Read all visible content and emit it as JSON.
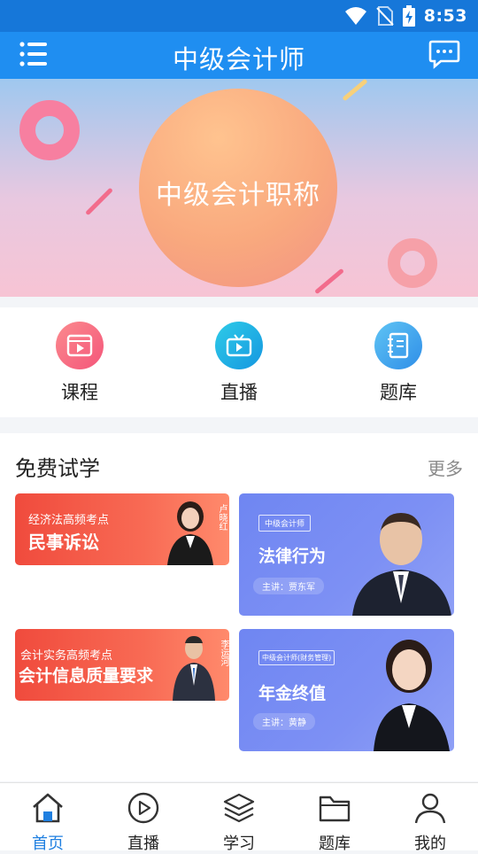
{
  "status_bar": {
    "time": "8:53"
  },
  "header": {
    "title": "中级会计师"
  },
  "banner": {
    "text": "中级会计职称"
  },
  "shortcuts": [
    {
      "label": "课程",
      "icon": "video-play-icon",
      "color": "#f86a76"
    },
    {
      "label": "直播",
      "icon": "tv-icon",
      "color": "#1cb8e6"
    },
    {
      "label": "题库",
      "icon": "notebook-icon",
      "color": "#3aa7ef"
    }
  ],
  "free_trial": {
    "title": "免费试学",
    "more": "更多",
    "cards": [
      {
        "sub": "经济法高频考点",
        "main": "民事诉讼",
        "signature": "卢晓红"
      },
      {
        "tag": "中级会计师",
        "main": "法律行为",
        "lecturer": "主讲：贾东军"
      },
      {
        "sub": "会计实务高频考点",
        "main": "会计信息质量要求",
        "signature": "李运河"
      },
      {
        "tag": "中级会计师(财务管理)",
        "main": "年金终值",
        "lecturer": "主讲：黄静"
      }
    ]
  },
  "tabs": [
    {
      "label": "首页",
      "icon": "home-icon",
      "active": true
    },
    {
      "label": "直播",
      "icon": "play-circle-icon",
      "active": false
    },
    {
      "label": "学习",
      "icon": "layers-icon",
      "active": false
    },
    {
      "label": "题库",
      "icon": "folder-icon",
      "active": false
    },
    {
      "label": "我的",
      "icon": "person-icon",
      "active": false
    }
  ],
  "colors": {
    "primary": "#1f8ef1",
    "status_bar": "#1677d9",
    "active_tab": "#1f7fe0",
    "card_red": "#f04b3d",
    "card_blue": "#7d90f4"
  }
}
